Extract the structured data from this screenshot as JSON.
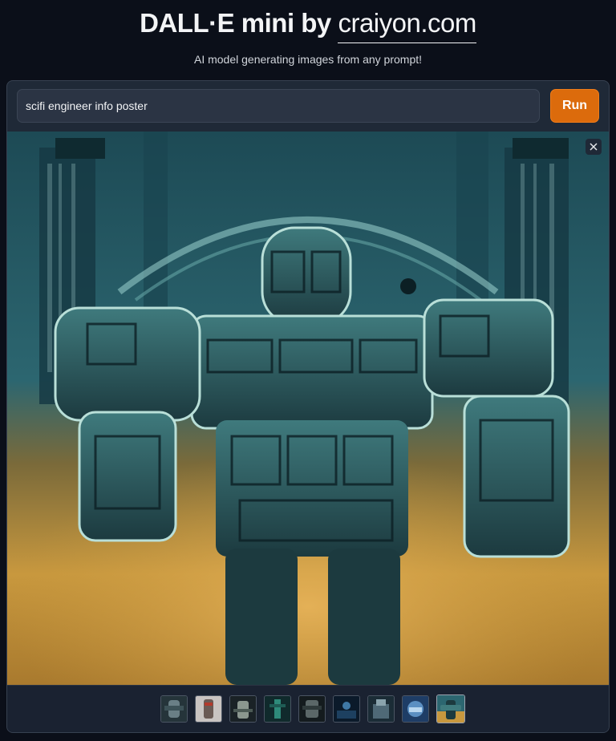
{
  "header": {
    "title_prefix": "DALL·E mini by ",
    "title_link": "craiyon.com",
    "subtitle": "AI model generating images from any prompt!"
  },
  "form": {
    "prompt_value": "scifi engineer info poster",
    "run_label": "Run"
  },
  "gallery": {
    "selected_index": 8,
    "thumbnail_count": 9
  },
  "colors": {
    "background": "#0b0f19",
    "panel": "#1f2937",
    "accent": "#dc6b0c"
  }
}
